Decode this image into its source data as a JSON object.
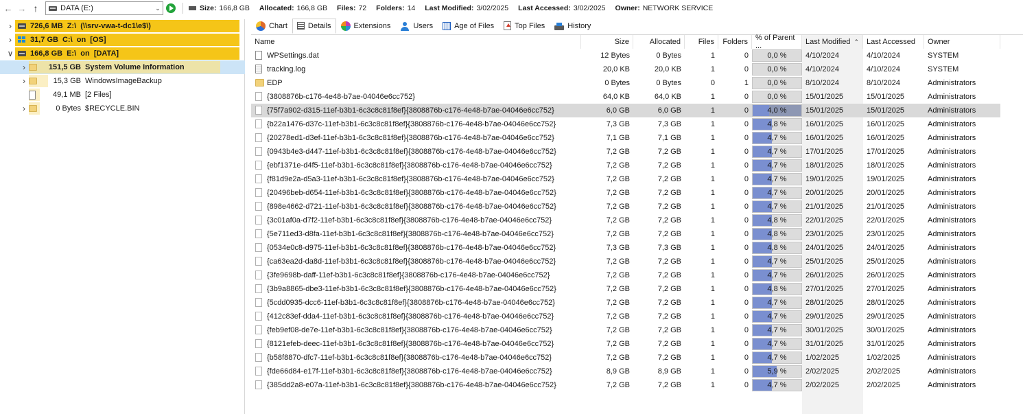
{
  "toolbar": {
    "back_icon": "arrow-left-icon",
    "forward_icon": "arrow-right-icon",
    "up_icon": "arrow-up-icon",
    "drive_value": "DATA (E:)",
    "size_label": "Size:",
    "size_value": "166,8 GB",
    "allocated_label": "Allocated:",
    "allocated_value": "166,8 GB",
    "files_label": "Files:",
    "files_value": "72",
    "folders_label": "Folders:",
    "folders_value": "14",
    "modified_label": "Last Modified:",
    "modified_value": "3/02/2025",
    "accessed_label": "Last Accessed:",
    "accessed_value": "3/02/2025",
    "owner_label": "Owner:",
    "owner_value": "NETWORK SERVICE"
  },
  "tree": [
    {
      "size": "726,6 MB",
      "name": "Z:\\  (\\\\srv-vwa-t-dc1\\e$\\)",
      "bold": true,
      "level": 0,
      "icon": "network-drive-icon",
      "bar": 1.0,
      "color": "#f5c518",
      "expander": ">"
    },
    {
      "size": "31,7 GB",
      "name": "C:\\  on  [OS]",
      "bold": true,
      "level": 0,
      "icon": "os-drive-icon",
      "bar": 1.0,
      "color": "#f5c518",
      "expander": ">"
    },
    {
      "size": "166,8 GB",
      "name": "E:\\  on  [DATA]",
      "bold": true,
      "level": 0,
      "icon": "drive-icon",
      "bar": 1.0,
      "color": "#f5c518",
      "expander": "v"
    },
    {
      "size": "151,5 GB",
      "name": "System Volume Information",
      "bold": true,
      "level": 1,
      "icon": "folder-icon",
      "bar": 0.91,
      "color": "#ede3a8",
      "expander": ">",
      "selected": true
    },
    {
      "size": "15,3 GB",
      "name": "WindowsImageBackup",
      "bold": false,
      "level": 1,
      "icon": "folder-icon",
      "bar": 0.09,
      "color": "#fbefc4",
      "expander": ">"
    },
    {
      "size": "49,1 MB",
      "name": "[2 Files]",
      "bold": false,
      "level": 1,
      "icon": "file-icon",
      "bar": 0.0,
      "color": "#fbefc4",
      "expander": ""
    },
    {
      "size": "0 Bytes",
      "name": "$RECYCLE.BIN",
      "bold": false,
      "level": 1,
      "icon": "folder-icon",
      "bar": 0.0,
      "color": "#fbefc4",
      "expander": ">"
    }
  ],
  "tabs": [
    {
      "label": "Chart",
      "icon": "pie-chart-icon",
      "cls": "ic-chart"
    },
    {
      "label": "Details",
      "icon": "details-list-icon",
      "cls": "ic-details",
      "active": true
    },
    {
      "label": "Extensions",
      "icon": "extensions-icon",
      "cls": "ic-ext"
    },
    {
      "label": "Users",
      "icon": "users-icon",
      "cls": "ic-users"
    },
    {
      "label": "Age of Files",
      "icon": "calendar-icon",
      "cls": "ic-age"
    },
    {
      "label": "Top Files",
      "icon": "top-files-icon",
      "cls": "ic-top"
    },
    {
      "label": "History",
      "icon": "history-icon",
      "cls": "ic-hist"
    }
  ],
  "columns": {
    "name": "Name",
    "size": "Size",
    "allocated": "Allocated",
    "files": "Files",
    "folders": "Folders",
    "pct": "% of Parent ...",
    "modified": "Last Modified",
    "accessed": "Last Accessed",
    "owner": "Owner",
    "sort_icon": "sort-up-icon"
  },
  "rows": [
    {
      "name": "WPSettings.dat",
      "type": "file",
      "size": "12 Bytes",
      "allocated": "0 Bytes",
      "files": "1",
      "folders": "0",
      "pct": "0,0 %",
      "pct_value": 0.0,
      "modified": "4/10/2024",
      "accessed": "4/10/2024",
      "owner": "SYSTEM"
    },
    {
      "name": "tracking.log",
      "type": "log",
      "size": "20,0 KB",
      "allocated": "20,0 KB",
      "files": "1",
      "folders": "0",
      "pct": "0,0 %",
      "pct_value": 0.0,
      "modified": "4/10/2024",
      "accessed": "4/10/2024",
      "owner": "SYSTEM"
    },
    {
      "name": "EDP",
      "type": "folder",
      "size": "0 Bytes",
      "allocated": "0 Bytes",
      "files": "0",
      "folders": "1",
      "pct": "0,0 %",
      "pct_value": 0.0,
      "modified": "8/10/2024",
      "accessed": "8/10/2024",
      "owner": "Administrators"
    },
    {
      "name": "{3808876b-c176-4e48-b7ae-04046e6cc752}",
      "type": "blank",
      "size": "64,0 KB",
      "allocated": "64,0 KB",
      "files": "1",
      "folders": "0",
      "pct": "0,0 %",
      "pct_value": 0.0,
      "modified": "15/01/2025",
      "accessed": "15/01/2025",
      "owner": "Administrators"
    },
    {
      "name": "{75f7a902-d315-11ef-b3b1-6c3c8c81f8ef}{3808876b-c176-4e48-b7ae-04046e6cc752}",
      "type": "blank",
      "size": "6,0 GB",
      "allocated": "6,0 GB",
      "files": "1",
      "folders": "0",
      "pct": "4,0 %",
      "pct_value": 4.0,
      "modified": "15/01/2025",
      "accessed": "15/01/2025",
      "owner": "Administrators",
      "selected": true
    },
    {
      "name": "{b22a1476-d37c-11ef-b3b1-6c3c8c81f8ef}{3808876b-c176-4e48-b7ae-04046e6cc752}",
      "type": "blank",
      "size": "7,3 GB",
      "allocated": "7,3 GB",
      "files": "1",
      "folders": "0",
      "pct": "4,8 %",
      "pct_value": 4.8,
      "modified": "16/01/2025",
      "accessed": "16/01/2025",
      "owner": "Administrators"
    },
    {
      "name": "{20278ed1-d3ef-11ef-b3b1-6c3c8c81f8ef}{3808876b-c176-4e48-b7ae-04046e6cc752}",
      "type": "blank",
      "size": "7,1 GB",
      "allocated": "7,1 GB",
      "files": "1",
      "folders": "0",
      "pct": "4,7 %",
      "pct_value": 4.7,
      "modified": "16/01/2025",
      "accessed": "16/01/2025",
      "owner": "Administrators"
    },
    {
      "name": "{0943b4e3-d447-11ef-b3b1-6c3c8c81f8ef}{3808876b-c176-4e48-b7ae-04046e6cc752}",
      "type": "blank",
      "size": "7,2 GB",
      "allocated": "7,2 GB",
      "files": "1",
      "folders": "0",
      "pct": "4,7 %",
      "pct_value": 4.7,
      "modified": "17/01/2025",
      "accessed": "17/01/2025",
      "owner": "Administrators"
    },
    {
      "name": "{ebf1371e-d4f5-11ef-b3b1-6c3c8c81f8ef}{3808876b-c176-4e48-b7ae-04046e6cc752}",
      "type": "blank",
      "size": "7,2 GB",
      "allocated": "7,2 GB",
      "files": "1",
      "folders": "0",
      "pct": "4,7 %",
      "pct_value": 4.7,
      "modified": "18/01/2025",
      "accessed": "18/01/2025",
      "owner": "Administrators"
    },
    {
      "name": "{f81d9e2a-d5a3-11ef-b3b1-6c3c8c81f8ef}{3808876b-c176-4e48-b7ae-04046e6cc752}",
      "type": "blank",
      "size": "7,2 GB",
      "allocated": "7,2 GB",
      "files": "1",
      "folders": "0",
      "pct": "4,7 %",
      "pct_value": 4.7,
      "modified": "19/01/2025",
      "accessed": "19/01/2025",
      "owner": "Administrators"
    },
    {
      "name": "{20496beb-d654-11ef-b3b1-6c3c8c81f8ef}{3808876b-c176-4e48-b7ae-04046e6cc752}",
      "type": "blank",
      "size": "7,2 GB",
      "allocated": "7,2 GB",
      "files": "1",
      "folders": "0",
      "pct": "4,7 %",
      "pct_value": 4.7,
      "modified": "20/01/2025",
      "accessed": "20/01/2025",
      "owner": "Administrators"
    },
    {
      "name": "{898e4662-d721-11ef-b3b1-6c3c8c81f8ef}{3808876b-c176-4e48-b7ae-04046e6cc752}",
      "type": "blank",
      "size": "7,2 GB",
      "allocated": "7,2 GB",
      "files": "1",
      "folders": "0",
      "pct": "4,7 %",
      "pct_value": 4.7,
      "modified": "21/01/2025",
      "accessed": "21/01/2025",
      "owner": "Administrators"
    },
    {
      "name": "{3c01af0a-d7f2-11ef-b3b1-6c3c8c81f8ef}{3808876b-c176-4e48-b7ae-04046e6cc752}",
      "type": "blank",
      "size": "7,2 GB",
      "allocated": "7,2 GB",
      "files": "1",
      "folders": "0",
      "pct": "4,8 %",
      "pct_value": 4.8,
      "modified": "22/01/2025",
      "accessed": "22/01/2025",
      "owner": "Administrators"
    },
    {
      "name": "{5e711ed3-d8fa-11ef-b3b1-6c3c8c81f8ef}{3808876b-c176-4e48-b7ae-04046e6cc752}",
      "type": "blank",
      "size": "7,2 GB",
      "allocated": "7,2 GB",
      "files": "1",
      "folders": "0",
      "pct": "4,8 %",
      "pct_value": 4.8,
      "modified": "23/01/2025",
      "accessed": "23/01/2025",
      "owner": "Administrators"
    },
    {
      "name": "{0534e0c8-d975-11ef-b3b1-6c3c8c81f8ef}{3808876b-c176-4e48-b7ae-04046e6cc752}",
      "type": "blank",
      "size": "7,3 GB",
      "allocated": "7,3 GB",
      "files": "1",
      "folders": "0",
      "pct": "4,8 %",
      "pct_value": 4.8,
      "modified": "24/01/2025",
      "accessed": "24/01/2025",
      "owner": "Administrators"
    },
    {
      "name": "{ca63ea2d-da8d-11ef-b3b1-6c3c8c81f8ef}{3808876b-c176-4e48-b7ae-04046e6cc752}",
      "type": "blank",
      "size": "7,2 GB",
      "allocated": "7,2 GB",
      "files": "1",
      "folders": "0",
      "pct": "4,7 %",
      "pct_value": 4.7,
      "modified": "25/01/2025",
      "accessed": "25/01/2025",
      "owner": "Administrators"
    },
    {
      "name": "{3fe9698b-daff-11ef-b3b1-6c3c8c81f8ef}{3808876b-c176-4e48-b7ae-04046e6cc752}",
      "type": "blank",
      "size": "7,2 GB",
      "allocated": "7,2 GB",
      "files": "1",
      "folders": "0",
      "pct": "4,7 %",
      "pct_value": 4.7,
      "modified": "26/01/2025",
      "accessed": "26/01/2025",
      "owner": "Administrators"
    },
    {
      "name": "{3b9a8865-dbe3-11ef-b3b1-6c3c8c81f8ef}{3808876b-c176-4e48-b7ae-04046e6cc752}",
      "type": "blank",
      "size": "7,2 GB",
      "allocated": "7,2 GB",
      "files": "1",
      "folders": "0",
      "pct": "4,8 %",
      "pct_value": 4.8,
      "modified": "27/01/2025",
      "accessed": "27/01/2025",
      "owner": "Administrators"
    },
    {
      "name": "{5cdd0935-dcc6-11ef-b3b1-6c3c8c81f8ef}{3808876b-c176-4e48-b7ae-04046e6cc752}",
      "type": "blank",
      "size": "7,2 GB",
      "allocated": "7,2 GB",
      "files": "1",
      "folders": "0",
      "pct": "4,7 %",
      "pct_value": 4.7,
      "modified": "28/01/2025",
      "accessed": "28/01/2025",
      "owner": "Administrators"
    },
    {
      "name": "{412c83ef-dda4-11ef-b3b1-6c3c8c81f8ef}{3808876b-c176-4e48-b7ae-04046e6cc752}",
      "type": "blank",
      "size": "7,2 GB",
      "allocated": "7,2 GB",
      "files": "1",
      "folders": "0",
      "pct": "4,7 %",
      "pct_value": 4.7,
      "modified": "29/01/2025",
      "accessed": "29/01/2025",
      "owner": "Administrators"
    },
    {
      "name": "{feb9ef08-de7e-11ef-b3b1-6c3c8c81f8ef}{3808876b-c176-4e48-b7ae-04046e6cc752}",
      "type": "blank",
      "size": "7,2 GB",
      "allocated": "7,2 GB",
      "files": "1",
      "folders": "0",
      "pct": "4,7 %",
      "pct_value": 4.7,
      "modified": "30/01/2025",
      "accessed": "30/01/2025",
      "owner": "Administrators"
    },
    {
      "name": "{8121efeb-deec-11ef-b3b1-6c3c8c81f8ef}{3808876b-c176-4e48-b7ae-04046e6cc752}",
      "type": "blank",
      "size": "7,2 GB",
      "allocated": "7,2 GB",
      "files": "1",
      "folders": "0",
      "pct": "4,7 %",
      "pct_value": 4.7,
      "modified": "31/01/2025",
      "accessed": "31/01/2025",
      "owner": "Administrators"
    },
    {
      "name": "{b58f8870-dfc7-11ef-b3b1-6c3c8c81f8ef}{3808876b-c176-4e48-b7ae-04046e6cc752}",
      "type": "blank",
      "size": "7,2 GB",
      "allocated": "7,2 GB",
      "files": "1",
      "folders": "0",
      "pct": "4,7 %",
      "pct_value": 4.7,
      "modified": "1/02/2025",
      "accessed": "1/02/2025",
      "owner": "Administrators"
    },
    {
      "name": "{fde66d84-e17f-11ef-b3b1-6c3c8c81f8ef}{3808876b-c176-4e48-b7ae-04046e6cc752}",
      "type": "blank",
      "size": "8,9 GB",
      "allocated": "8,9 GB",
      "files": "1",
      "folders": "0",
      "pct": "5,9 %",
      "pct_value": 5.9,
      "modified": "2/02/2025",
      "accessed": "2/02/2025",
      "owner": "Administrators"
    },
    {
      "name": "{385dd2a8-e07a-11ef-b3b1-6c3c8c81f8ef}{3808876b-c176-4e48-b7ae-04046e6cc752}",
      "type": "blank",
      "size": "7,2 GB",
      "allocated": "7,2 GB",
      "files": "1",
      "folders": "0",
      "pct": "4,7 %",
      "pct_value": 4.7,
      "modified": "2/02/2025",
      "accessed": "2/02/2025",
      "owner": "Administrators"
    }
  ]
}
